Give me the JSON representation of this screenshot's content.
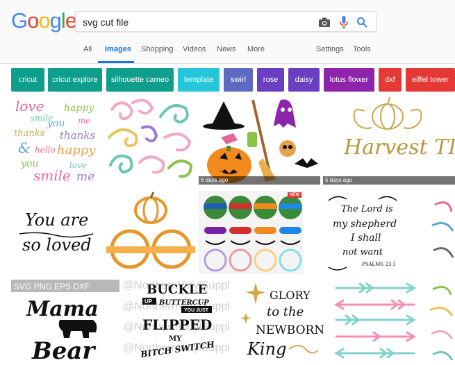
{
  "logo": {
    "letters": [
      "G",
      "o",
      "o",
      "g",
      "l",
      "e"
    ],
    "colors": [
      "#4285F4",
      "#EA4335",
      "#FBBC05",
      "#4285F4",
      "#34A853",
      "#EA4335"
    ]
  },
  "search": {
    "value": "svg cut file",
    "placeholder": ""
  },
  "tabs": [
    {
      "label": "All"
    },
    {
      "label": "Images"
    },
    {
      "label": "Shopping"
    },
    {
      "label": "Videos"
    },
    {
      "label": "News"
    },
    {
      "label": "More"
    },
    {
      "label": "Settings"
    },
    {
      "label": "Tools"
    }
  ],
  "chips": [
    {
      "label": "cricut",
      "color": "#0f9d8c"
    },
    {
      "label": "cricut explore",
      "color": "#0f9d8c"
    },
    {
      "label": "silhouette cameo",
      "color": "#0f9d8c"
    },
    {
      "label": "template",
      "color": "#26c6da"
    },
    {
      "label": "swirl",
      "color": "#5c6bc0"
    },
    {
      "label": "rose",
      "color": "#6a3fc4"
    },
    {
      "label": "daisy",
      "color": "#6a3fc4"
    },
    {
      "label": "lotus flower",
      "color": "#8e24aa"
    },
    {
      "label": "dxf",
      "color": "#e53935"
    },
    {
      "label": "eiffel tower",
      "color": "#e53935"
    }
  ],
  "results": {
    "badge_6_days": "6 days ago",
    "badge_5_days": "5 days ago",
    "new_badge": "NEW",
    "love_words": [
      "love",
      "smile",
      "happy",
      "you",
      "me",
      "thanks",
      "thanks",
      "&",
      "hello",
      "happy",
      "you",
      "love",
      "smile",
      "me"
    ],
    "harvest_text": "Harvest TIME",
    "loved_text_1": "You are",
    "loved_text_2": "so loved",
    "lord_lines": [
      "The Lord is",
      "my shepherd",
      "I shall",
      "not want"
    ],
    "psalm_ref": "PSALMS 23:1",
    "mama_formats": "SVG PNG EPS DXF",
    "mama_text_1": "Mama",
    "mama_text_2": "Bear",
    "buckle_lines": [
      "BUCKLE",
      "UP",
      "BUTTERCUP",
      "YOU JUST",
      "FLIPPED",
      "MY",
      "BITCH SWITCH"
    ],
    "watermark_buckle": "@NorthernVinylSupply",
    "glory_lines": [
      "GLORY",
      "to the",
      "NEWBORN",
      "King"
    ]
  }
}
